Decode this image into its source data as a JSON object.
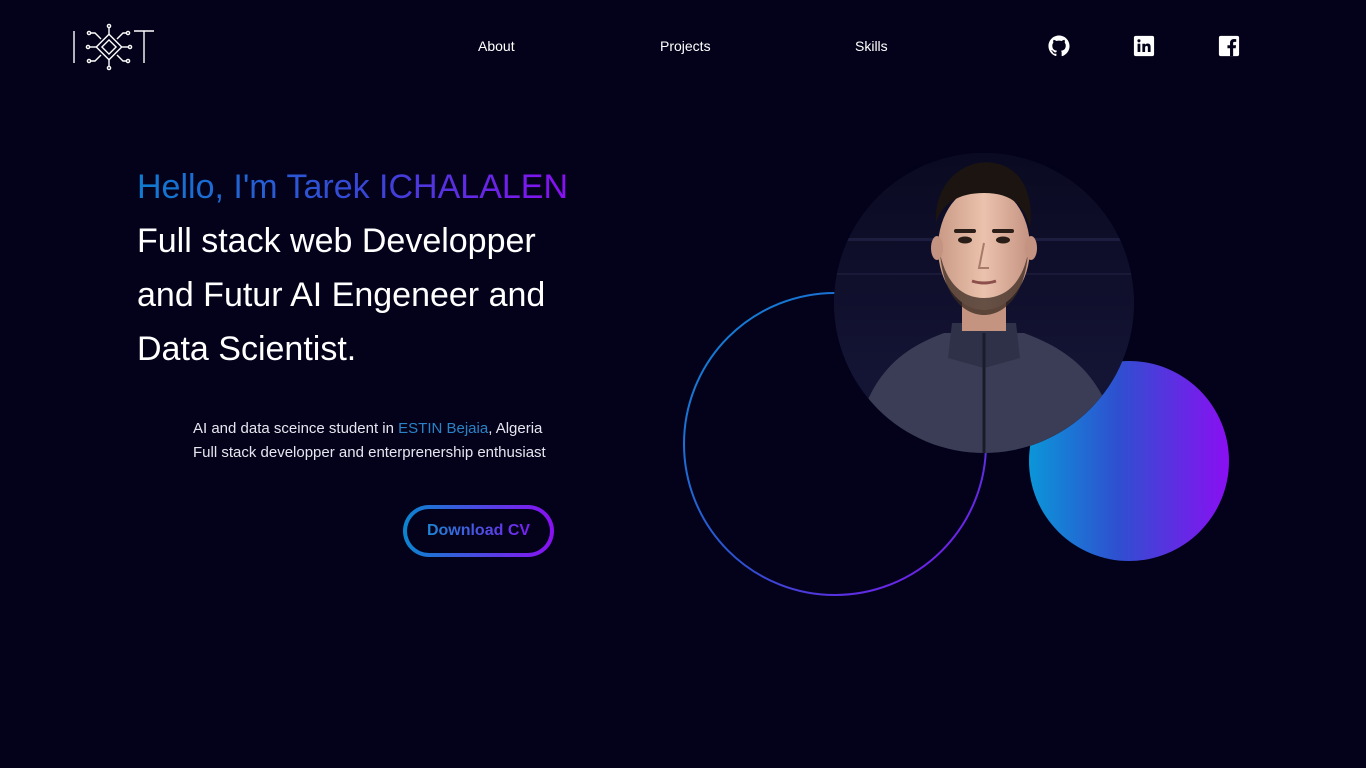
{
  "header": {
    "logo_text": "IOT",
    "nav": [
      {
        "label": "About"
      },
      {
        "label": "Projects"
      },
      {
        "label": "Skills"
      }
    ],
    "social": [
      {
        "icon": "github-icon"
      },
      {
        "icon": "linkedin-icon"
      },
      {
        "icon": "facebook-icon"
      }
    ]
  },
  "hero": {
    "greeting": "Hello, I'm Tarek ICHALALEN",
    "role_lines": [
      "Full stack web Developper",
      "and Futur AI Engeneer and",
      "Data Scientist."
    ],
    "description": {
      "line1_before": "AI and data sceince student in ",
      "line1_link": "ESTIN Bejaia",
      "line1_after": ", Algeria",
      "line2": "Full stack developper and enterprenership enthusiast"
    },
    "cta_label": "Download CV"
  },
  "art": {
    "profile_photo": "portrait-photo",
    "colors": {
      "background": "#03021a",
      "gradient_start": "#0b96d8",
      "gradient_end": "#8a0ff3",
      "link": "#2a83c6"
    }
  }
}
